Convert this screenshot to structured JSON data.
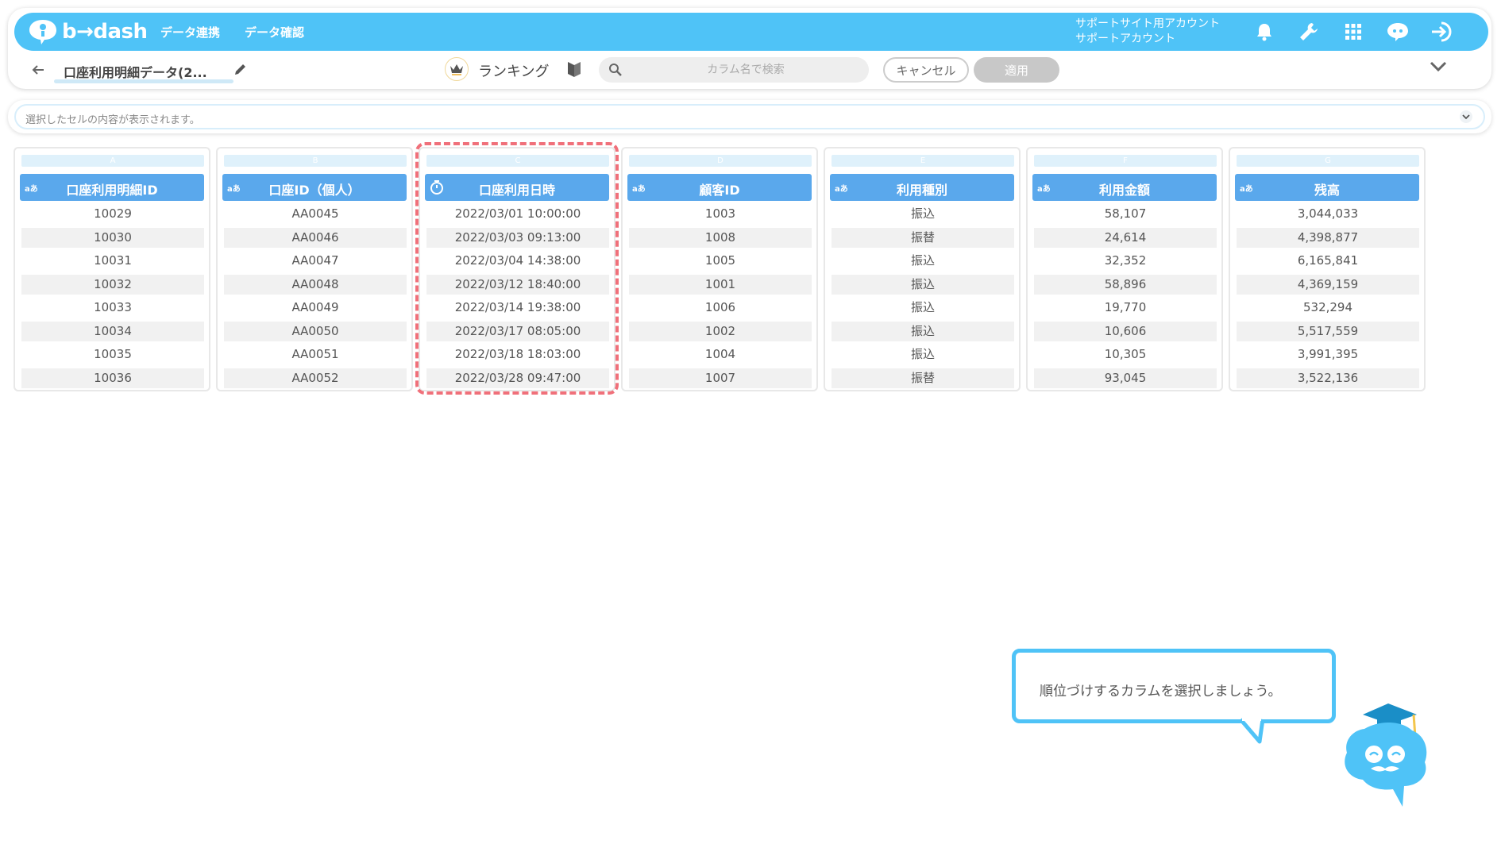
{
  "app": {
    "logo_text": "b→dash",
    "nav": [
      "データ連携",
      "データ確認"
    ],
    "account_line1": "サポートサイト用アカウント",
    "account_line2": "サポートアカウント",
    "icons": [
      "bell-icon",
      "wrench-icon",
      "apps-grid-icon",
      "chat-icon",
      "logout-icon"
    ],
    "brand_color": "#4fc3f7"
  },
  "toolbar": {
    "title": "口座利用明細データ(2...",
    "ranking_label": "ランキング",
    "search_placeholder": "カラム名で検索",
    "cancel_label": "キャンセル",
    "apply_label": "適用"
  },
  "cell_bar": {
    "placeholder": "選択したセルの内容が表示されます。"
  },
  "columns": [
    {
      "letter": "A",
      "type": "aあ",
      "name": "口座利用明細ID",
      "cells": [
        "10029",
        "10030",
        "10031",
        "10032",
        "10033",
        "10034",
        "10035",
        "10036"
      ]
    },
    {
      "letter": "B",
      "type": "aあ",
      "name": "口座ID（個人）",
      "cells": [
        "AA0045",
        "AA0046",
        "AA0047",
        "AA0048",
        "AA0049",
        "AA0050",
        "AA0051",
        "AA0052"
      ]
    },
    {
      "letter": "C",
      "type": "clock",
      "name": "口座利用日時",
      "highlighted": true,
      "cells": [
        "2022/03/01 10:00:00",
        "2022/03/03 09:13:00",
        "2022/03/04 14:38:00",
        "2022/03/12 18:40:00",
        "2022/03/14 19:38:00",
        "2022/03/17 08:05:00",
        "2022/03/18 18:03:00",
        "2022/03/28 09:47:00"
      ]
    },
    {
      "letter": "D",
      "type": "aあ",
      "name": "顧客ID",
      "cells": [
        "1003",
        "1008",
        "1005",
        "1001",
        "1006",
        "1002",
        "1004",
        "1007"
      ]
    },
    {
      "letter": "E",
      "type": "aあ",
      "name": "利用種別",
      "cells": [
        "振込",
        "振替",
        "振込",
        "振込",
        "振込",
        "振込",
        "振込",
        "振替"
      ]
    },
    {
      "letter": "F",
      "type": "aあ",
      "name": "利用金額",
      "cells": [
        "58,107",
        "24,614",
        "32,352",
        "58,896",
        "19,770",
        "10,606",
        "10,305",
        "93,045"
      ]
    },
    {
      "letter": "G",
      "type": "aあ",
      "name": "残高",
      "cells": [
        "3,044,033",
        "4,398,877",
        "6,165,841",
        "4,369,159",
        "532,294",
        "5,517,559",
        "3,991,395",
        "3,522,136"
      ]
    }
  ],
  "guide": {
    "message": "順位づけするカラムを選択しましょう。"
  },
  "colors": {
    "header_blue": "#5aa8ec",
    "highlight_dash": "#f0707a"
  }
}
